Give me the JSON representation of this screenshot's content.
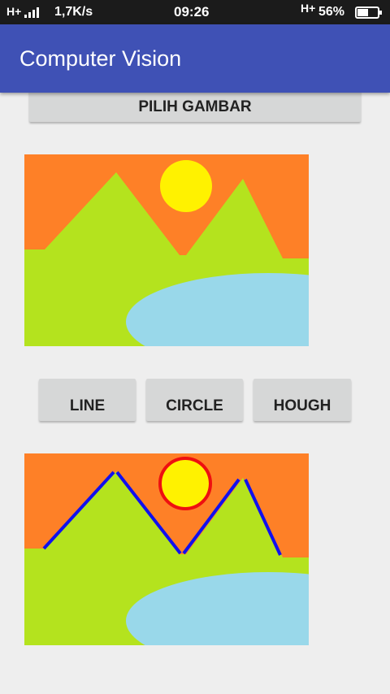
{
  "status_bar": {
    "network_left": "H+",
    "speed": "1,7K/s",
    "time": "09:26",
    "network_right": "H+",
    "battery_percent": "56%",
    "battery_level": 0.56
  },
  "app_bar": {
    "title": "Computer Vision",
    "color": "#3f51b5"
  },
  "buttons": {
    "pick_image": "PILIH GAMBAR",
    "line": "LINE",
    "circle": "CIRCLE",
    "hough": "HOUGH"
  },
  "images": {
    "input": {
      "icon": "landscape-image",
      "colors": {
        "sky": "#fe8027",
        "sun": "#fff200",
        "hills": "#b4e31e",
        "lake": "#99d8ea"
      }
    },
    "output": {
      "icon": "landscape-image-detected",
      "colors": {
        "line": "#1010ee",
        "circle": "#ee1010"
      }
    }
  }
}
